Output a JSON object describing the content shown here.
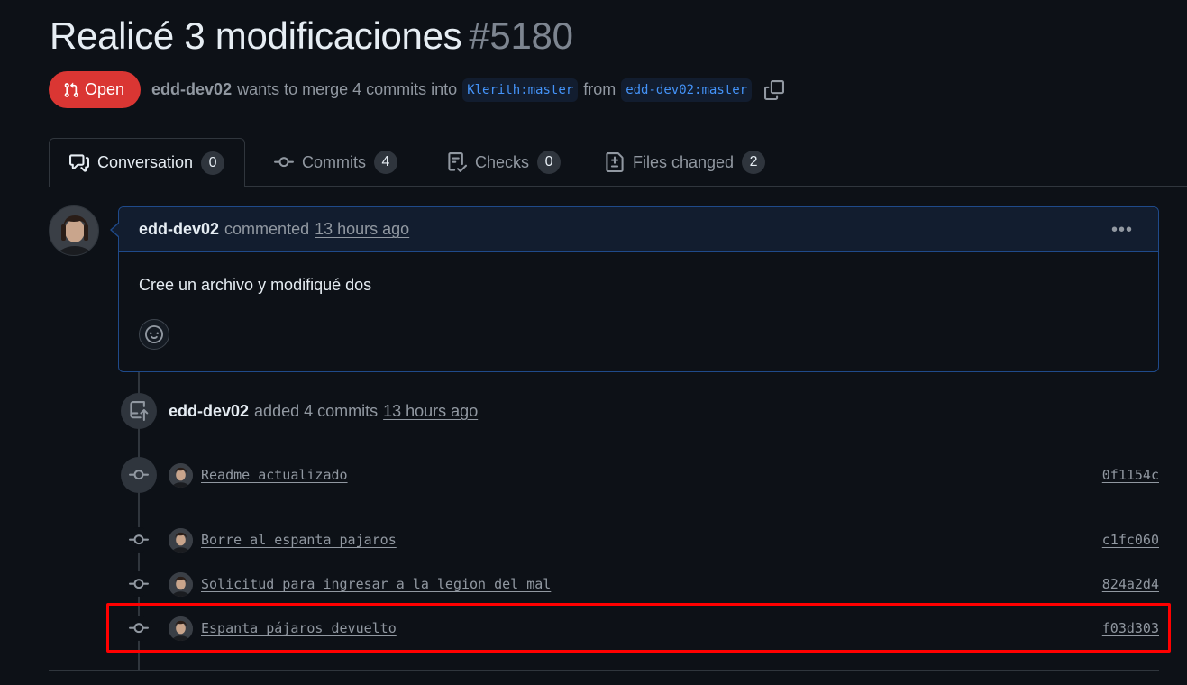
{
  "pr": {
    "title": "Realicé 3 modificaciones",
    "number": "#5180",
    "state": "Open",
    "author": "edd-dev02",
    "merge_text": "wants to merge 4 commits into",
    "base_branch": "Klerith:master",
    "from_text": "from",
    "head_branch": "edd-dev02:master"
  },
  "tabs": [
    {
      "label": "Conversation",
      "count": "0",
      "icon": "conversation-icon"
    },
    {
      "label": "Commits",
      "count": "4",
      "icon": "commit-icon"
    },
    {
      "label": "Checks",
      "count": "0",
      "icon": "checks-icon"
    },
    {
      "label": "Files changed",
      "count": "2",
      "icon": "file-diff-icon"
    }
  ],
  "comment": {
    "author": "edd-dev02",
    "action": "commented",
    "time": "13 hours ago",
    "body": "Cree un archivo y modifiqué dos"
  },
  "added_event": {
    "author": "edd-dev02",
    "action": "added 4 commits",
    "time": "13 hours ago"
  },
  "commits": [
    {
      "message": "Readme actualizado",
      "sha": "0f1154c"
    },
    {
      "message": "Borre al espanta pajaros",
      "sha": "c1fc060"
    },
    {
      "message": "Solicitud para ingresar a la legion del mal",
      "sha": "824a2d4"
    },
    {
      "message": "Espanta pájaros devuelto",
      "sha": "f03d303"
    }
  ],
  "colors": {
    "background": "#0d1117",
    "open_badge": "#da3633",
    "branch_text": "#4493f8",
    "highlight_box": "#ff0000"
  }
}
